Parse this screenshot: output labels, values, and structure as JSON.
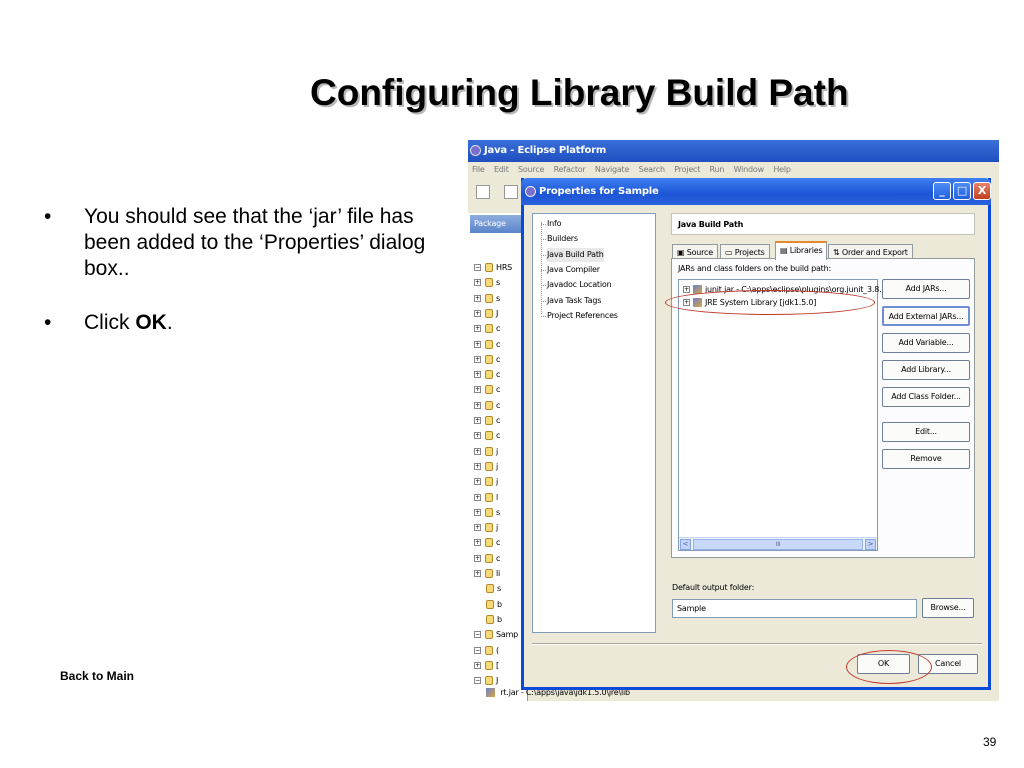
{
  "slide": {
    "title": "Configuring Library Build Path",
    "bullets": [
      {
        "dot": "•",
        "text": "You should see that the ‘jar’ file has been added to the ‘Properties’ dialog box.."
      },
      {
        "dot": "•",
        "prefix": "Click ",
        "bold": "OK",
        "suffix": "."
      }
    ],
    "back_link": "Back to Main",
    "page_number": "39"
  },
  "eclipse": {
    "window_title": "Java - Eclipse Platform",
    "menu": [
      "File",
      "Edit",
      "Source",
      "Refactor",
      "Navigate",
      "Search",
      "Project",
      "Run",
      "Window",
      "Help"
    ],
    "package_tab": "Package",
    "tree": [
      {
        "label": "HRS",
        "expander": "−"
      },
      {
        "label": "s",
        "expander": "+"
      },
      {
        "label": "s",
        "expander": "+"
      },
      {
        "label": "J",
        "expander": "+"
      },
      {
        "label": "c",
        "expander": "+"
      },
      {
        "label": "c",
        "expander": "+"
      },
      {
        "label": "c",
        "expander": "+"
      },
      {
        "label": "c",
        "expander": "+"
      },
      {
        "label": "c",
        "expander": "+"
      },
      {
        "label": "c",
        "expander": "+"
      },
      {
        "label": "c",
        "expander": "+"
      },
      {
        "label": "c",
        "expander": "+"
      },
      {
        "label": "j",
        "expander": "+"
      },
      {
        "label": "j",
        "expander": "+"
      },
      {
        "label": "j",
        "expander": "+"
      },
      {
        "label": "l",
        "expander": "+"
      },
      {
        "label": "s",
        "expander": "+"
      },
      {
        "label": "j",
        "expander": "+"
      },
      {
        "label": "c",
        "expander": "+"
      },
      {
        "label": "c",
        "expander": "+"
      },
      {
        "label": "li",
        "expander": "+"
      },
      {
        "label": "s",
        "expander": ""
      },
      {
        "label": "b",
        "expander": ""
      },
      {
        "label": "b",
        "expander": ""
      },
      {
        "label": "Samp",
        "expander": "−"
      },
      {
        "label": "(",
        "expander": "−"
      },
      {
        "label": "[",
        "expander": "+"
      },
      {
        "label": "J",
        "expander": "−"
      }
    ],
    "bottom_row": "rt.jar - C:\\apps\\java\\jdk1.5.0\\jre\\lib"
  },
  "dialog": {
    "title": "Properties for Sample",
    "window_buttons": {
      "minimize": "_",
      "maximize": "□",
      "close": "X"
    },
    "nav_items": [
      "Info",
      "Builders",
      "Java Build Path",
      "Java Compiler",
      "Javadoc Location",
      "Java Task Tags",
      "Project References"
    ],
    "selected_nav": "Java Build Path",
    "page_header": "Java Build Path",
    "tabs": [
      {
        "label": "Source",
        "active": false
      },
      {
        "label": "Projects",
        "active": false
      },
      {
        "label": "Libraries",
        "active": true
      },
      {
        "label": "Order and Export",
        "active": false
      }
    ],
    "jar_list_label": "JARs and class folders on the build path:",
    "jar_entries": [
      "junit.jar - C:\\apps\\eclipse\\plugins\\org.junit_3.8.:",
      "JRE System Library [jdk1.5.0]"
    ],
    "scroll": {
      "left": "<",
      "right": ">",
      "thumb": "III"
    },
    "side_buttons": [
      "Add JARs...",
      "Add External JARs...",
      "Add Variable...",
      "Add Library...",
      "Add Class Folder...",
      "Edit...",
      "Remove"
    ],
    "focused_button": "Add External JARs...",
    "output_label": "Default output folder:",
    "output_value": "Sample",
    "browse": "Browse...",
    "ok": "OK",
    "cancel": "Cancel"
  },
  "colors": {
    "highlight": "#c0392b",
    "title_bar": "#1f4fc0",
    "tab_accent": "#e68b2c"
  }
}
